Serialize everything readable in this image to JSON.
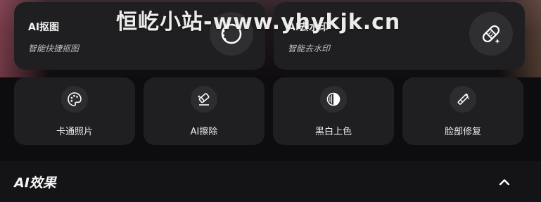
{
  "watermark": "恒屹小站-www.yhykjk.cn",
  "feature_cards": [
    {
      "title": "AI抠图",
      "subtitle": "智能快捷抠图",
      "icon": "cutout-icon"
    },
    {
      "title": "AI去水印",
      "subtitle": "智能去水印",
      "icon": "bandage-icon"
    }
  ],
  "tools": [
    {
      "label": "卡通照片",
      "icon": "palette-icon"
    },
    {
      "label": "AI擦除",
      "icon": "eraser-icon"
    },
    {
      "label": "黑白上色",
      "icon": "contrast-icon"
    },
    {
      "label": "脸部修复",
      "icon": "magic-wand-icon"
    }
  ],
  "section": {
    "title": "AI效果",
    "toggle_icon": "chevron-up-icon"
  },
  "colors": {
    "card_bg": "#1f1f21",
    "page_bg": "#0d0d0f",
    "icon_bg": "#2d2d2f"
  }
}
